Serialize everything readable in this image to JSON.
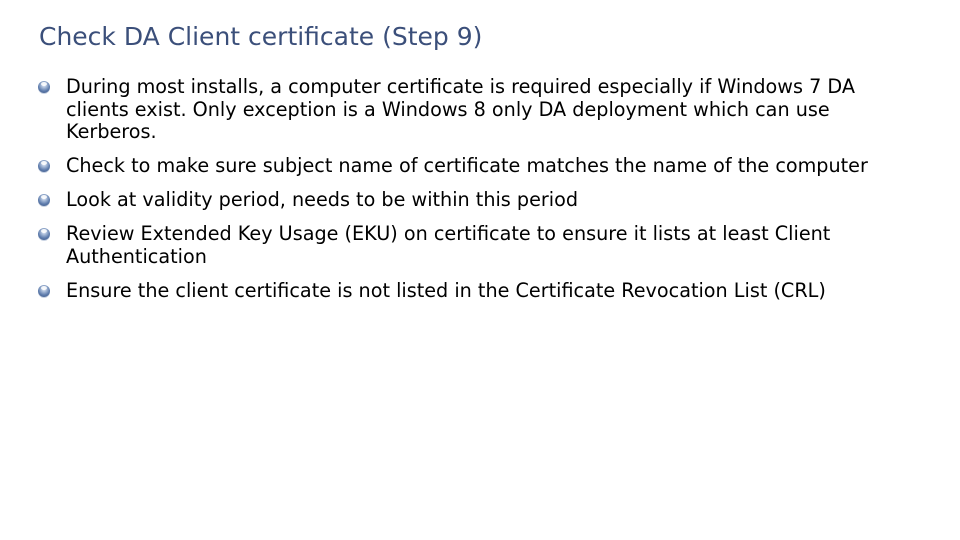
{
  "slide": {
    "title": "Check DA Client certificate (Step 9)",
    "bullets": [
      {
        "icon": "bullet-orb-icon",
        "text": "During most installs, a computer certificate is required especially if Windows 7 DA clients exist.  Only exception is a Windows 8 only DA deployment which can use Kerberos."
      },
      {
        "icon": "bullet-orb-icon",
        "text": "Check to make sure subject name of certificate matches the name of the computer"
      },
      {
        "icon": "bullet-orb-icon",
        "text": "Look at validity period, needs to be within this period"
      },
      {
        "icon": "bullet-orb-icon",
        "text": "Review Extended Key Usage (EKU) on certificate to ensure it lists at least Client Authentication"
      },
      {
        "icon": "bullet-orb-icon",
        "text": "Ensure the client certificate is not listed in the Certificate Revocation List (CRL)"
      }
    ]
  },
  "colors": {
    "title": "#3b4f7a",
    "body_text": "#000000",
    "bullet": "#5d7bab",
    "background": "#ffffff"
  }
}
